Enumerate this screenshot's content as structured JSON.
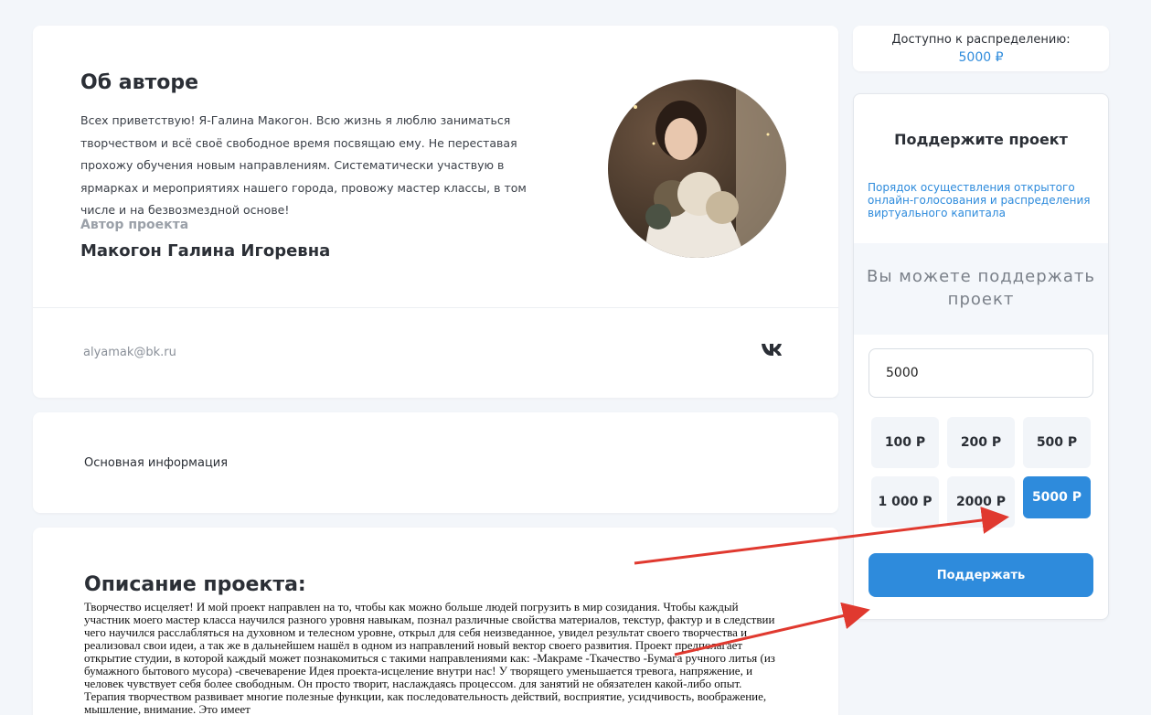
{
  "author": {
    "heading": "Об авторе",
    "bio": "Всех приветствую! Я-Галина Макогон. Всю жизнь я люблю заниматься творчеством и всё своё свободное время посвящаю ему. Не переставая прохожу обучения новым направлениям. Систематически участвую в ярмарках и мероприятиях нашего города, провожу мастер классы, в том числе и на безвозмездной основе!",
    "role_label": "Автор проекта",
    "name": "Макогон Галина Игоревна",
    "email": "alyamak@bk.ru",
    "social_icon": "vk-icon"
  },
  "info": {
    "label": "Основная информация"
  },
  "description": {
    "heading": "Описание проекта:",
    "text": "Творчество исцеляет! И мой проект направлен на то, чтобы как можно больше людей погрузить в мир созидания. Чтобы каждый участник моего мастер класса научился разного уровня навыкам, познал различные свойства материалов, текстур, фактур и в следствии чего научился расслабляться на духовном и телесном уровне, открыл для себя неизведанное, увидел результат своего творчества и реализовал свои идеи, а так же в дальнейшем нашёл в одном из направлений новый вектор своего развития. Проект предполагает открытие студии, в которой каждый может познакомиться с такими направлениями как: -Макраме -Ткачество -Бумага ручного литья (из бумажного бытового мусора) -свечеварение Идея проекта-исцеление внутри нас! У творящего уменьшается тревога, напряжение, и человек чувствует себя более свободным. Он просто творит, наслаждаясь процессом. для занятий не обязателен какой-либо опыт. Терапия творчеством развивает многие полезные функции, как последовательность действий, восприятие, усидчивость, воображение, мышление, внимание. Это имеет"
  },
  "balance": {
    "label": "Доступно к распределению:",
    "value": "5000 ₽"
  },
  "support": {
    "title": "Поддержите проект",
    "link": "Порядок осуществления открытого онлайн-голосования и распределения виртуального капитала",
    "band_text": "Вы можете поддержать проект",
    "amount_value": "5000",
    "amounts": [
      "100 Р",
      "200 Р",
      "500 Р",
      "1 000 Р",
      "2000 Р",
      "5000 Р"
    ],
    "selected_amount": "5000 Р",
    "submit_label": "Поддержать"
  },
  "colors": {
    "accent": "#2e8bdc",
    "background": "#f3f6fa",
    "arrow": "#e0392f"
  }
}
